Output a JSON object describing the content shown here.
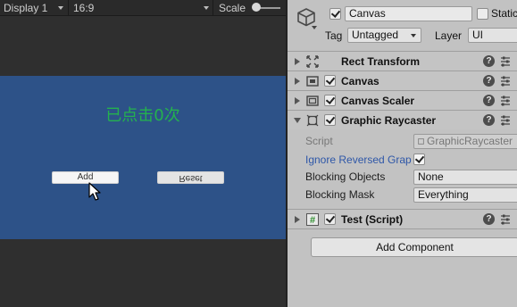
{
  "game": {
    "display": "Display 1",
    "aspect": "16:9",
    "scale_label": "Scale",
    "click_count_text": "已点击0次",
    "add_label": "Add",
    "reset_label": "Reset",
    "canvas_color": "#2d5288",
    "text_color": "#24b24e"
  },
  "inspector": {
    "object_name": "Canvas",
    "static_label": "Static",
    "tag_label": "Tag",
    "tag_value": "Untagged",
    "layer_label": "Layer",
    "layer_value": "UI",
    "components": {
      "rect_transform": "Rect Transform",
      "canvas": "Canvas",
      "canvas_scaler": "Canvas Scaler",
      "graphic_raycaster": "Graphic Raycaster",
      "test_script": "Test (Script)"
    },
    "raycaster_props": {
      "script_label": "Script",
      "script_value": "GraphicRaycaster",
      "ignore_reversed_label": "Ignore Reversed Grap",
      "ignore_reversed_checked": true,
      "blocking_objects_label": "Blocking Objects",
      "blocking_objects_value": "None",
      "blocking_mask_label": "Blocking Mask",
      "blocking_mask_value": "Everything"
    },
    "help_symbol": "?",
    "add_component_label": "Add Component"
  },
  "icons": {
    "gameobject": "cube-icon",
    "rect_transform": "rect-transform-icon",
    "canvas": "canvas-icon",
    "canvas_scaler": "canvas-scaler-icon",
    "raycaster": "raycaster-icon",
    "script": "script-icon",
    "help": "help-icon",
    "presets": "sliders-icon",
    "cursor": "mouse-cursor-icon"
  }
}
